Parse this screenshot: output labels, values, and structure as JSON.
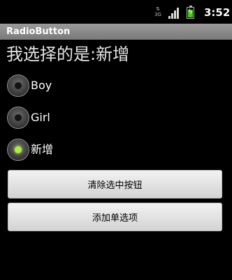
{
  "status_bar": {
    "network_type": "3G",
    "signal_icon": "signal-icon",
    "battery_icon": "battery-charging-icon",
    "time": "3:52"
  },
  "app": {
    "title": "RadioButton"
  },
  "main": {
    "selection_label": "我选择的是:新增",
    "radios": [
      {
        "label": "Boy",
        "checked": false
      },
      {
        "label": "Girl",
        "checked": false
      },
      {
        "label": "新增",
        "checked": true
      }
    ],
    "clear_button_label": "清除选中按钮",
    "add_button_label": "添加单选项"
  },
  "colors": {
    "radio_checked": "#a8f03a",
    "title_bar": "#8a8a8a"
  }
}
